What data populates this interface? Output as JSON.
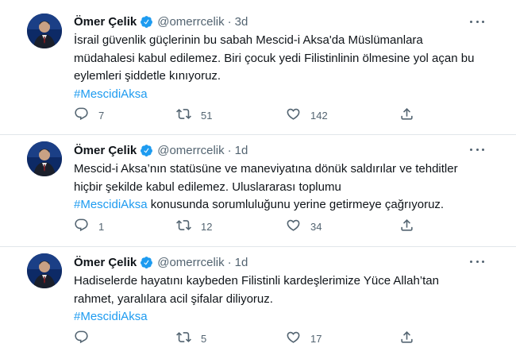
{
  "tweets": [
    {
      "author": {
        "name": "Ömer Çelik",
        "handle": "@omerrcelik"
      },
      "separator": "·",
      "time": "3d",
      "text_lines": [
        "İsrail güvenlik güçlerinin bu sabah Mescid-i Aksa'da Müslümanlara",
        "müdahalesi kabul edilemez. Biri çocuk yedi Filistinlinin ölmesine yol açan bu",
        "eylemleri şiddetle kınıyoruz."
      ],
      "hashtag": "#MescidiAksa",
      "counts": {
        "replies": "7",
        "retweets": "51",
        "likes": "142"
      }
    },
    {
      "author": {
        "name": "Ömer Çelik",
        "handle": "@omerrcelik"
      },
      "separator": "·",
      "time": "1d",
      "text_lines": [
        "Mescid-i Aksa’nın statüsüne ve maneviyatına dönük saldırılar ve tehditler",
        "hiçbir şekilde kabul edilemez. Uluslararası toplumu"
      ],
      "hashtag": "#MescidiAksa",
      "hashtag_tail": " konusunda sorumluluğunu yerine getirmeye çağrıyoruz.",
      "counts": {
        "replies": "1",
        "retweets": "12",
        "likes": "34"
      }
    },
    {
      "author": {
        "name": "Ömer Çelik",
        "handle": "@omerrcelik"
      },
      "separator": "·",
      "time": "1d",
      "text_lines": [
        "Hadiselerde hayatını kaybeden Filistinli kardeşlerimize Yüce Allah’tan",
        "rahmet, yaralılara acil şifalar diliyoruz."
      ],
      "hashtag": "#MescidiAksa",
      "counts": {
        "replies": "",
        "retweets": "5",
        "likes": "17"
      }
    }
  ],
  "icons": {
    "verified": "verified-badge-icon",
    "more": "more-horizontal-icon",
    "reply": "reply-icon",
    "retweet": "retweet-icon",
    "like": "heart-icon",
    "share": "share-icon"
  },
  "colors": {
    "accent": "#1d9bf0",
    "text": "#0f1419",
    "secondary": "#536471",
    "divider": "#e1e6ea"
  }
}
